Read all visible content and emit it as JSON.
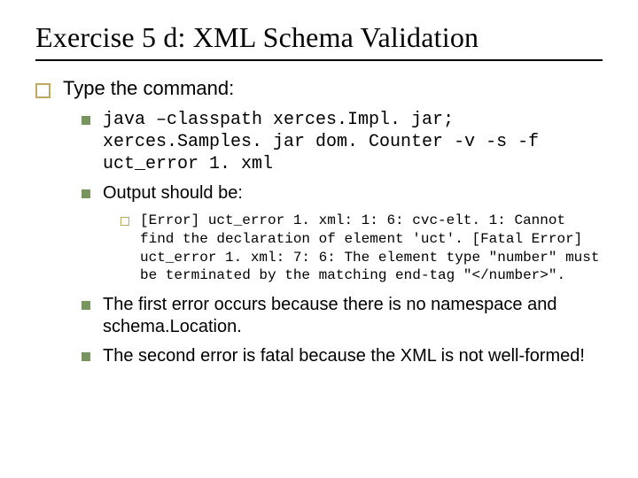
{
  "title": "Exercise 5 d: XML Schema Validation",
  "lvl1": {
    "text": "Type the command:"
  },
  "lvl2": {
    "item0": "java –classpath xerces.Impl. jar; xerces.Samples. jar dom. Counter -v -s -f uct_error 1. xml",
    "item1": "Output should be:",
    "item2": "The first error occurs because there is no namespace and schema.Location.",
    "item3": "The second error is fatal because the XML is not well-formed!"
  },
  "lvl3": {
    "output": "[Error] uct_error 1. xml: 1: 6: cvc-elt. 1: Cannot find the declaration of element 'uct'. [Fatal Error] uct_error 1. xml: 7: 6: The element type \"number\" must be terminated by the matching end-tag \"</number>\"."
  }
}
